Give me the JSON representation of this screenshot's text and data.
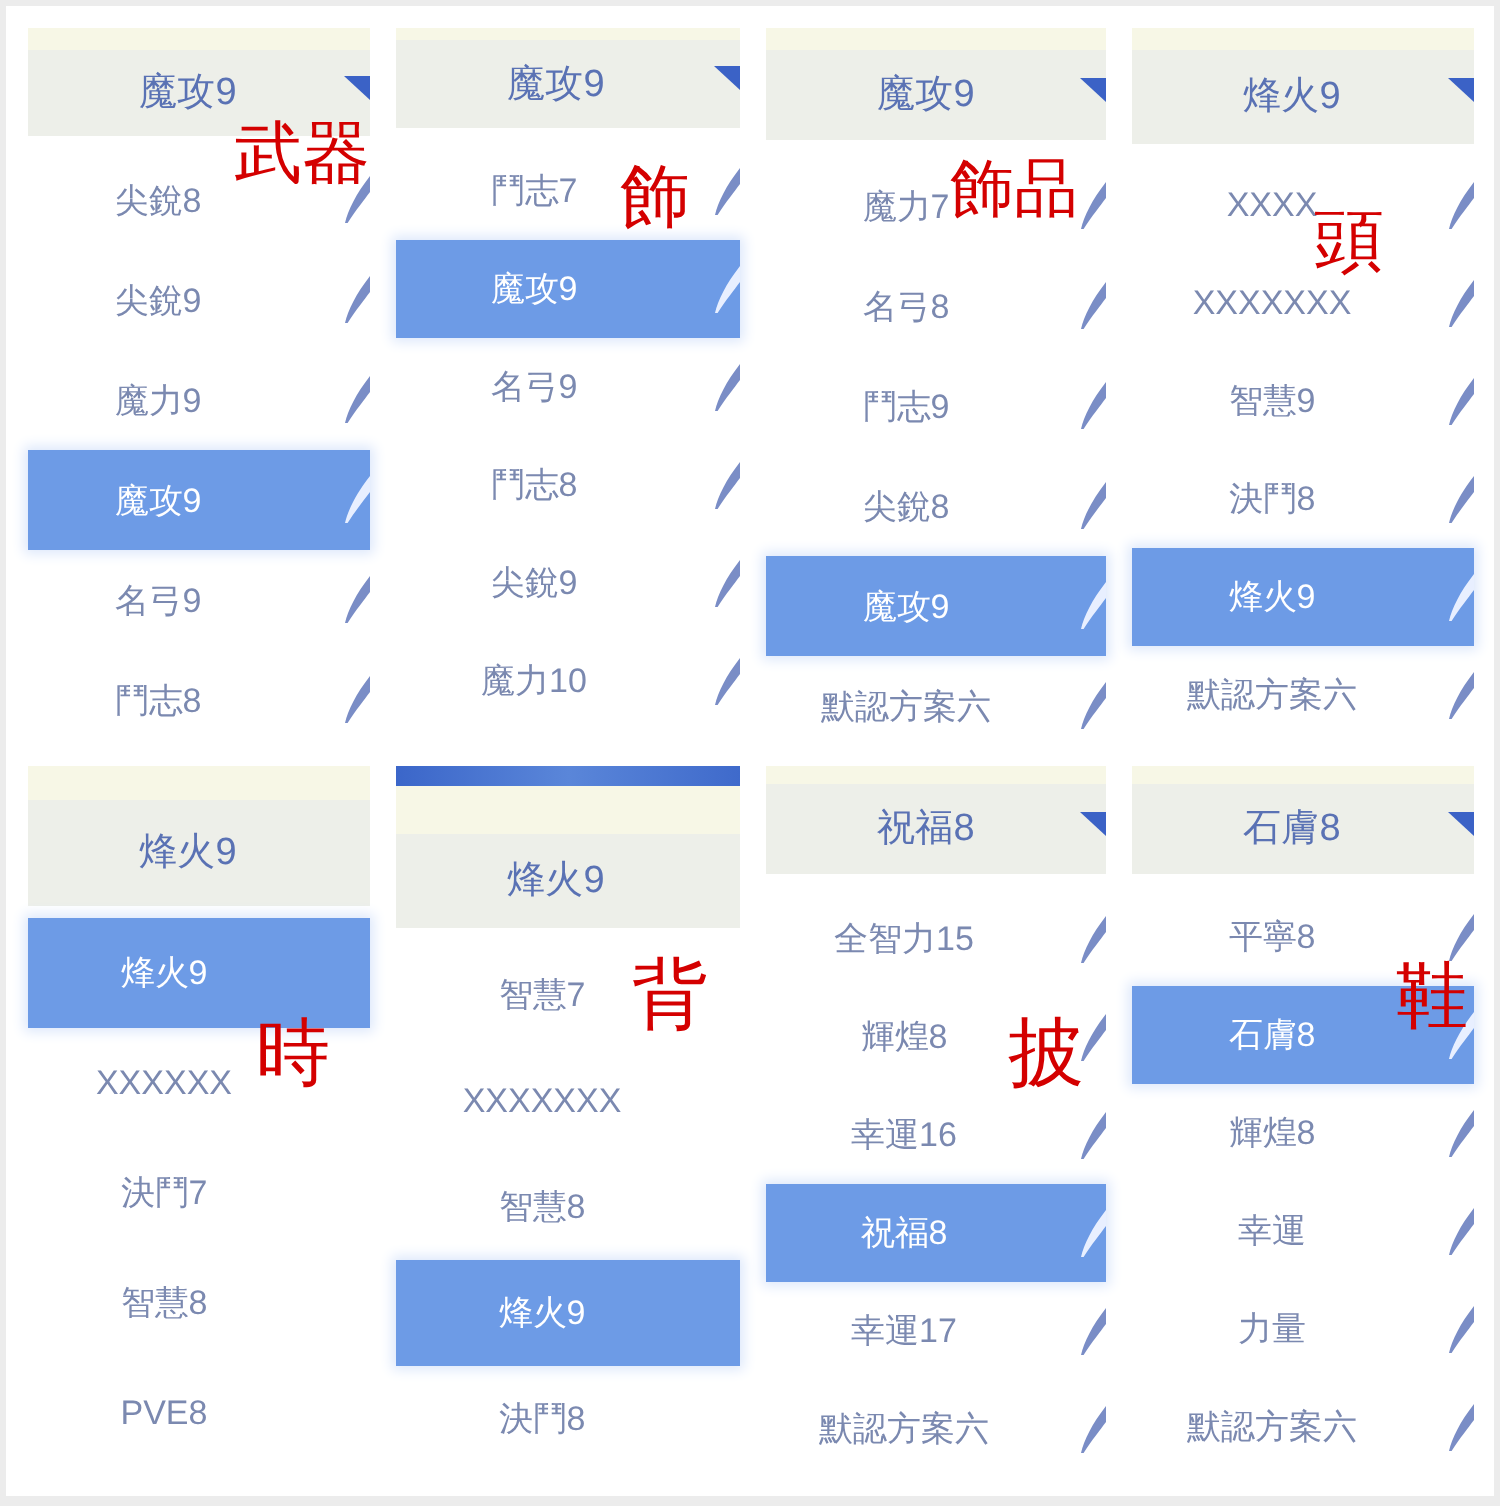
{
  "panels": [
    {
      "top_bar": false,
      "title": "魔攻9",
      "dropdown_arrow": true,
      "edit_icons": true,
      "items": [
        {
          "label": "尖銳8",
          "selected": false
        },
        {
          "label": "尖銳9",
          "selected": false
        },
        {
          "label": "魔力9",
          "selected": false
        },
        {
          "label": "魔攻9",
          "selected": true
        },
        {
          "label": "名弓9",
          "selected": false
        },
        {
          "label": "鬥志8",
          "selected": false
        }
      ],
      "annotation": "武器"
    },
    {
      "top_bar": false,
      "title": "魔攻9",
      "dropdown_arrow": true,
      "edit_icons": true,
      "items": [
        {
          "label": "鬥志7",
          "selected": false
        },
        {
          "label": "魔攻9",
          "selected": true
        },
        {
          "label": "名弓9",
          "selected": false
        },
        {
          "label": "鬥志8",
          "selected": false
        },
        {
          "label": "尖銳9",
          "selected": false
        },
        {
          "label": "魔力10",
          "selected": false
        }
      ],
      "annotation": "飾"
    },
    {
      "top_bar": false,
      "title": "魔攻9",
      "dropdown_arrow": true,
      "edit_icons": true,
      "items": [
        {
          "label": "魔力7",
          "selected": false
        },
        {
          "label": "名弓8",
          "selected": false
        },
        {
          "label": "鬥志9",
          "selected": false
        },
        {
          "label": "尖銳8",
          "selected": false
        },
        {
          "label": "魔攻9",
          "selected": true
        },
        {
          "label": "默認方案六",
          "selected": false
        }
      ],
      "annotation": "飾品"
    },
    {
      "top_bar": false,
      "title": "烽火9",
      "dropdown_arrow": true,
      "edit_icons": true,
      "items": [
        {
          "label": "XXXX",
          "selected": false
        },
        {
          "label": "XXXXXXX",
          "selected": false
        },
        {
          "label": "智慧9",
          "selected": false
        },
        {
          "label": "決鬥8",
          "selected": false
        },
        {
          "label": "烽火9",
          "selected": true
        },
        {
          "label": "默認方案六",
          "selected": false
        }
      ],
      "annotation": "頭"
    },
    {
      "top_bar": false,
      "title": "烽火9",
      "dropdown_arrow": false,
      "edit_icons": false,
      "items": [
        {
          "label": "烽火9",
          "selected": true
        },
        {
          "label": "XXXXXX",
          "selected": false
        },
        {
          "label": "決鬥7",
          "selected": false
        },
        {
          "label": "智慧8",
          "selected": false
        },
        {
          "label": "PVE8",
          "selected": false
        }
      ],
      "annotation": "時"
    },
    {
      "top_bar": true,
      "title": "烽火9",
      "dropdown_arrow": false,
      "edit_icons": false,
      "items": [
        {
          "label": "智慧7",
          "selected": false
        },
        {
          "label": "XXXXXXX",
          "selected": false
        },
        {
          "label": "智慧8",
          "selected": false
        },
        {
          "label": "烽火9",
          "selected": true
        },
        {
          "label": "決鬥8",
          "selected": false
        }
      ],
      "annotation": "背"
    },
    {
      "top_bar": false,
      "title": "祝福8",
      "dropdown_arrow": true,
      "edit_icons": true,
      "items": [
        {
          "label": "全智力15",
          "selected": false
        },
        {
          "label": "輝煌8",
          "selected": false
        },
        {
          "label": "幸運16",
          "selected": false
        },
        {
          "label": "祝福8",
          "selected": true
        },
        {
          "label": "幸運17",
          "selected": false
        },
        {
          "label": "默認方案六",
          "selected": false
        }
      ],
      "annotation": "披"
    },
    {
      "top_bar": false,
      "title": "石膚8",
      "dropdown_arrow": true,
      "edit_icons": true,
      "items": [
        {
          "label": "平寧8",
          "selected": false
        },
        {
          "label": "石膚8",
          "selected": true
        },
        {
          "label": "輝煌8",
          "selected": false
        },
        {
          "label": "幸運",
          "selected": false
        },
        {
          "label": "力量",
          "selected": false
        },
        {
          "label": "默認方案六",
          "selected": false
        }
      ],
      "annotation": "鞋"
    }
  ]
}
